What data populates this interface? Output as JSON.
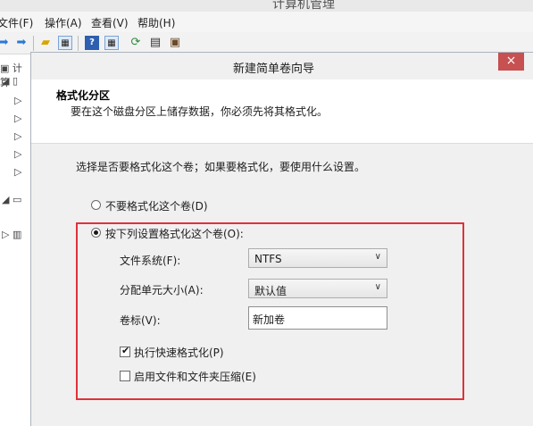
{
  "window": {
    "title": "计算机管理"
  },
  "menu": [
    {
      "label": "文件(F)"
    },
    {
      "label": "操作(A)"
    },
    {
      "label": "查看(V)"
    },
    {
      "label": "帮助(H)"
    }
  ],
  "toolbar": {
    "icons": [
      "back-arrow-icon",
      "forward-arrow-icon",
      "up-folder-icon",
      "show-pane-icon",
      "help-icon",
      "properties-icon",
      "refresh-icon",
      "export-icon",
      "disk-icon"
    ]
  },
  "tree": {
    "root_label": "计算"
  },
  "dialog": {
    "title": "新建简单卷向导",
    "close_glyph": "×",
    "header": {
      "title": "格式化分区",
      "description": "要在这个磁盘分区上储存数据，你必须先将其格式化。"
    },
    "question": "选择是否要格式化这个卷；如果要格式化，要使用什么设置。",
    "options": {
      "no_format": "不要格式化这个卷(D)",
      "format_with": "按下列设置格式化这个卷(O):"
    },
    "fields": {
      "file_system_label": "文件系统(F):",
      "file_system_value": "NTFS",
      "allocation_label": "分配单元大小(A):",
      "allocation_value": "默认值",
      "volume_label_label": "卷标(V):",
      "volume_label_value": "新加卷"
    },
    "checkboxes": {
      "quick_format": "执行快速格式化(P)",
      "quick_format_checked": true,
      "compression": "启用文件和文件夹压缩(E)",
      "compression_checked": false
    }
  },
  "colors": {
    "highlight": "#e0313a",
    "close_button": "#c75050",
    "dialog_body": "#f0f0f0"
  }
}
